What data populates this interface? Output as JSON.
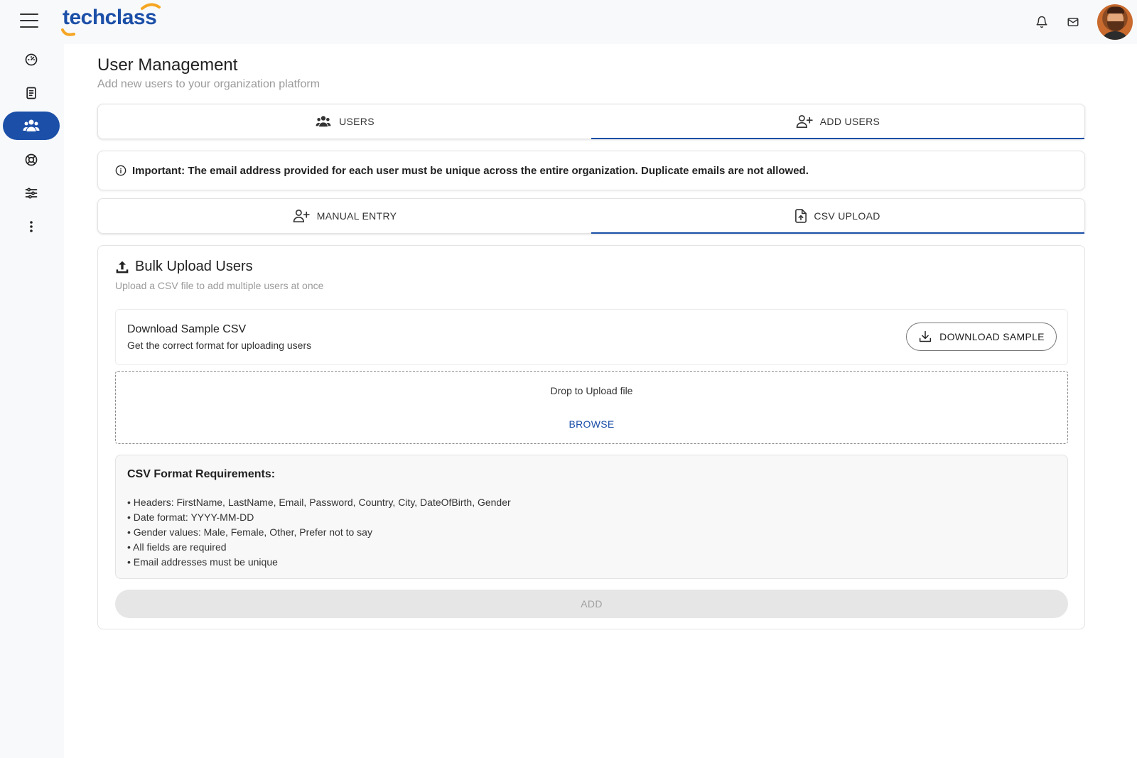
{
  "app": {
    "logo_text": "techclass",
    "brand_color": "#1b4fa8",
    "accent_color": "#f5a623"
  },
  "topbar": {
    "icons": [
      "menu-icon",
      "bell-icon",
      "mail-icon",
      "avatar"
    ]
  },
  "sidebar": {
    "items": [
      {
        "icon": "dashboard-icon",
        "active": false
      },
      {
        "icon": "book-icon",
        "active": false
      },
      {
        "icon": "users-icon",
        "active": true
      },
      {
        "icon": "support-icon",
        "active": false
      },
      {
        "icon": "sliders-icon",
        "active": false
      },
      {
        "icon": "more-vertical-icon",
        "active": false
      }
    ]
  },
  "page": {
    "title": "User Management",
    "subtitle": "Add new users to your organization platform"
  },
  "main_tabs": [
    {
      "label": "USERS",
      "icon": "users-group-icon",
      "selected": false
    },
    {
      "label": "ADD USERS",
      "icon": "user-plus-icon",
      "selected": true
    }
  ],
  "notice": {
    "text": "Important: The email address provided for each user must be unique across the entire organization. Duplicate emails are not allowed.",
    "icon": "info-icon"
  },
  "entry_tabs": [
    {
      "label": "MANUAL ENTRY",
      "icon": "user-plus-icon",
      "selected": false
    },
    {
      "label": "CSV UPLOAD",
      "icon": "file-upload-icon",
      "selected": true
    }
  ],
  "bulk": {
    "title": "Bulk Upload Users",
    "subtitle": "Upload a CSV file to add multiple users at once",
    "sample": {
      "title": "Download Sample CSV",
      "subtitle": "Get the correct format for uploading users",
      "button_label": "DOWNLOAD SAMPLE"
    },
    "drop": {
      "text": "Drop to Upload file",
      "browse_label": "BROWSE"
    },
    "requirements": {
      "title": "CSV Format Requirements:",
      "items": [
        "• Headers: FirstName, LastName, Email, Password, Country, City, DateOfBirth, Gender",
        "• Date format: YYYY-MM-DD",
        "• Gender values: Male, Female, Other, Prefer not to say",
        "• All fields are required",
        "• Email addresses must be unique"
      ]
    },
    "add_button_label": "ADD"
  }
}
